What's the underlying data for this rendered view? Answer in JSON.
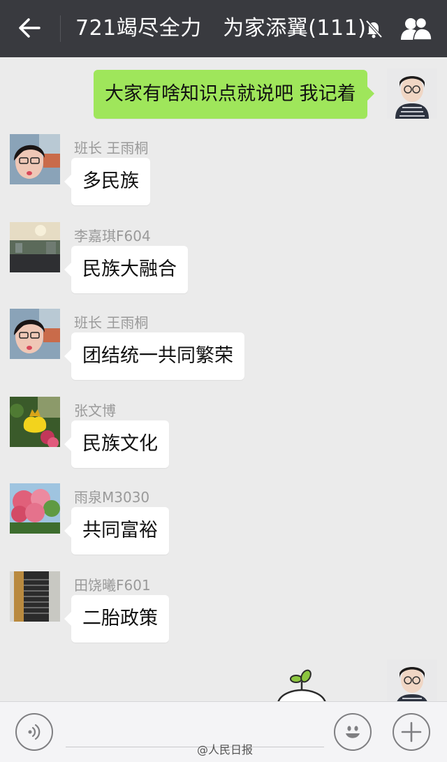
{
  "header": {
    "title": "721竭尽全力　为家添翼(111)",
    "back_icon": "back-arrow-icon",
    "mute_icon": "bell-muted-icon",
    "group_icon": "group-members-icon"
  },
  "messages": [
    {
      "side": "right",
      "text": "大家有啥知识点就说吧 我记着"
    },
    {
      "side": "left",
      "sender": "班长 王雨桐",
      "text": "多民族"
    },
    {
      "side": "left",
      "sender": "李嘉琪F604",
      "text": "民族大融合"
    },
    {
      "side": "left",
      "sender": "班长 王雨桐",
      "text": "团结统一共同繁荣"
    },
    {
      "side": "left",
      "sender": "张文博",
      "text": "民族文化"
    },
    {
      "side": "left",
      "sender": "雨泉M3030",
      "text": "共同富裕"
    },
    {
      "side": "left",
      "sender": "田饶曦F601",
      "text": "二胎政策"
    }
  ],
  "input_bar": {
    "voice_icon": "voice-icon",
    "emoji_icon": "emoji-icon",
    "plus_icon": "plus-icon"
  },
  "watermark": "@人民日报",
  "colors": {
    "header_bg": "#393a3f",
    "chat_bg": "#ebebeb",
    "own_bubble": "#9fe65b",
    "other_bubble": "#ffffff"
  }
}
